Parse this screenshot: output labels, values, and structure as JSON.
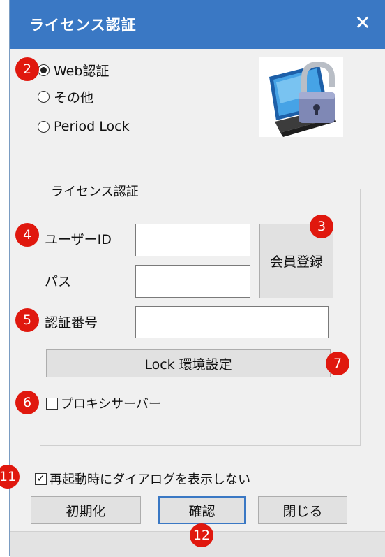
{
  "window": {
    "title": "ライセンス認証",
    "close_glyph": "✕"
  },
  "auth_mode": {
    "options": [
      {
        "label": "Web認証",
        "selected": true
      },
      {
        "label": "その他",
        "selected": false
      },
      {
        "label": "Period Lock",
        "selected": false
      }
    ]
  },
  "license_group": {
    "legend": "ライセンス認証",
    "user_id_label": "ユーザーID",
    "user_id_value": "",
    "password_label": "パス",
    "password_value": "",
    "member_register_button": "会員登録",
    "auth_number_label": "認証番号",
    "auth_number_value": "",
    "lock_env_button": "Lock 環境設定",
    "proxy_checkbox_label": "プロキシサーバー",
    "proxy_checked": false
  },
  "no_dialog_checkbox": {
    "label": "再起動時にダイアログを表示しない",
    "checked": true
  },
  "buttons": {
    "init": "初期化",
    "confirm": "確認",
    "close": "閉じる"
  },
  "annotations": {
    "m2": "2",
    "m3": "3",
    "m4": "4",
    "m5": "5",
    "m6": "6",
    "m7": "7",
    "m11": "11",
    "m12": "12"
  },
  "colors": {
    "titlebar": "#3a78c4",
    "marker": "#e0180e",
    "window_bg": "#f0f0f0"
  },
  "icons": {
    "lock_image": "open-padlock-laptop-icon",
    "check_glyph": "✓"
  }
}
